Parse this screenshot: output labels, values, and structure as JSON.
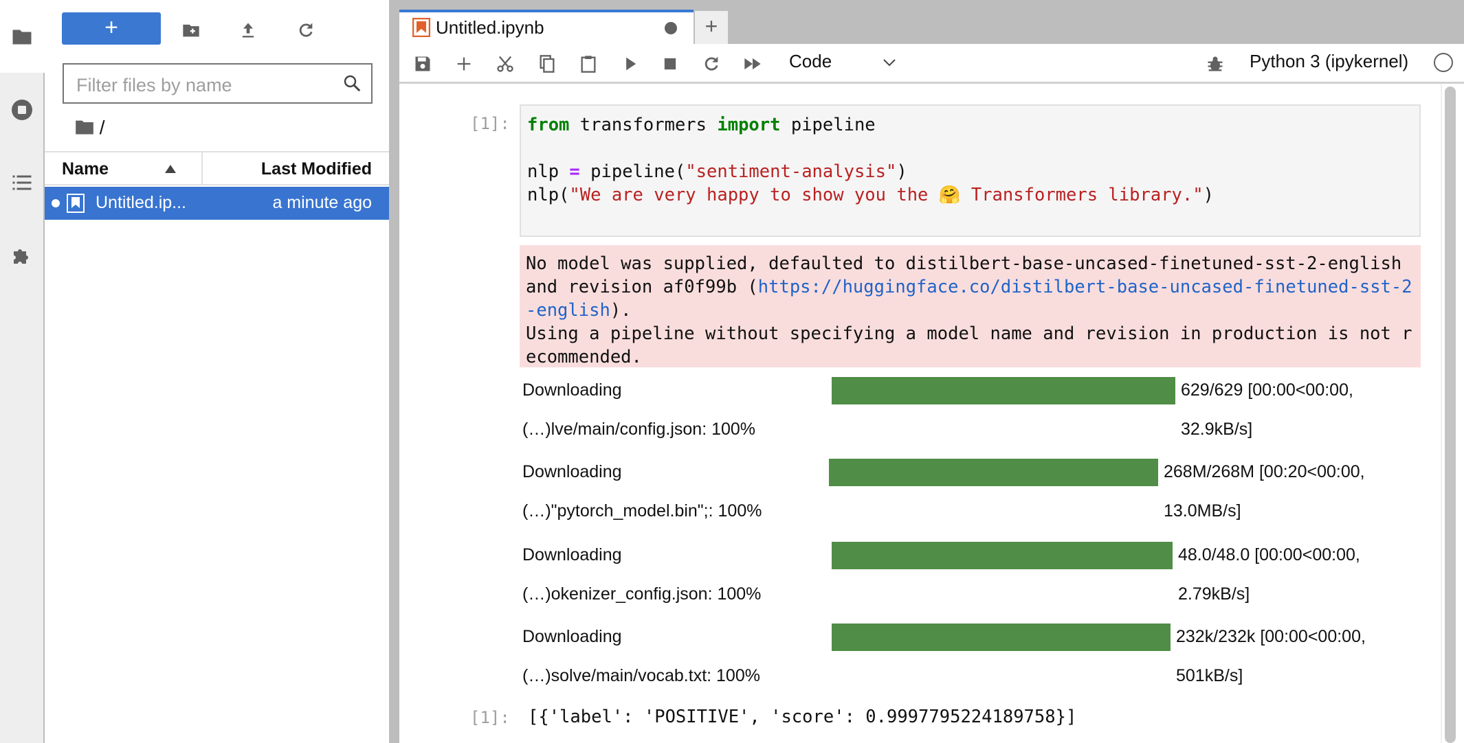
{
  "sidebar": {
    "icons": [
      "folder-icon",
      "stop-circle-icon",
      "list-icon",
      "puzzle-icon"
    ]
  },
  "filebrowser": {
    "new_label": "+",
    "filter_placeholder": "Filter files by name",
    "breadcrumb": "/",
    "columns": {
      "name": "Name",
      "modified": "Last Modified"
    },
    "files": [
      {
        "name": "Untitled.ip...",
        "modified": "a minute ago",
        "selected": true,
        "running": true
      }
    ]
  },
  "tabs": [
    {
      "title": "Untitled.ipynb",
      "unsaved": true
    }
  ],
  "toolbar": {
    "cell_type": "Code",
    "kernel": "Python 3 (ipykernel)"
  },
  "colors": {
    "accent": "#3874d0",
    "progress": "#508d46",
    "stderr_bg": "#f9dddd"
  },
  "cell": {
    "prompt": "[1]:",
    "code": {
      "l1_kw1": "from",
      "l1_mid": " transformers ",
      "l1_kw2": "import",
      "l1_end": " pipeline",
      "l2_a": "nlp ",
      "l2_op": "=",
      "l2_b": " pipeline(",
      "l2_str": "\"sentiment-analysis\"",
      "l2_c": ")",
      "l3_a": "nlp(",
      "l3_str": "\"We are very happy to show you the 🤗 Transformers library.\"",
      "l3_c": ")"
    },
    "stderr": {
      "t1": "No model was supplied, defaulted to distilbert-base-uncased-finetuned-sst-2-english and revision af0f99b (",
      "link": "https://huggingface.co/distilbert-base-uncased-finetuned-sst-2-english",
      "t2": ").\nUsing a pipeline without specifying a model name and revision in production is not recommended."
    },
    "downloads": [
      {
        "label": "Downloading",
        "file": "(…)lve/main/config.json: 100%",
        "stats1": "629/629 [00:00<00:00,",
        "stats2": "32.9kB/s]",
        "percent": 100
      },
      {
        "label": "Downloading",
        "file": "(…)\"pytorch_model.bin\";: 100%",
        "stats1": "268M/268M [00:20<00:00,",
        "stats2": "13.0MB/s]",
        "percent": 100
      },
      {
        "label": "Downloading",
        "file": "(…)okenizer_config.json: 100%",
        "stats1": "48.0/48.0 [00:00<00:00,",
        "stats2": "2.79kB/s]",
        "percent": 100
      },
      {
        "label": "Downloading",
        "file": "(…)solve/main/vocab.txt: 100%",
        "stats1": "232k/232k [00:00<00:00,",
        "stats2": "501kB/s]",
        "percent": 100
      }
    ],
    "output_prompt": "[1]:",
    "output": "[{'label': 'POSITIVE', 'score': 0.9997795224189758}]"
  }
}
